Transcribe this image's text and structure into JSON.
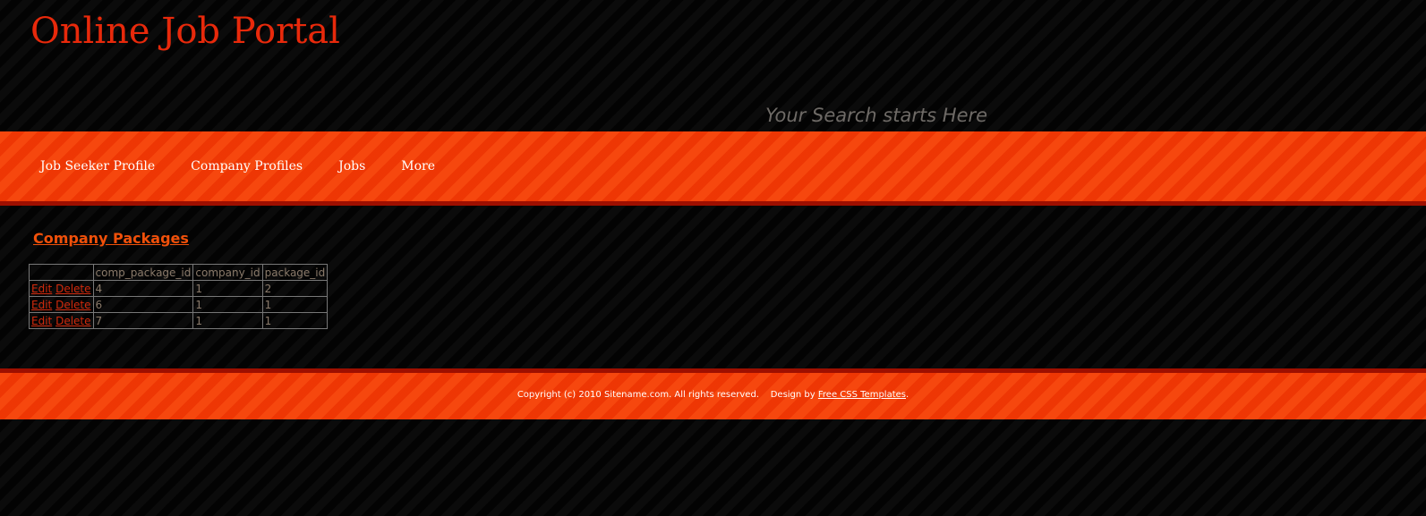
{
  "header": {
    "site_title": "Online Job Portal",
    "search_tagline": "Your Search starts Here"
  },
  "nav": {
    "items": [
      {
        "label": "Job Seeker Profile"
      },
      {
        "label": "Company Profiles"
      },
      {
        "label": "Jobs"
      },
      {
        "label": "More"
      }
    ]
  },
  "main": {
    "heading": "Company Packages",
    "table": {
      "columns": [
        "",
        "comp_package_id",
        "company_id",
        "package_id"
      ],
      "edit_label": "Edit",
      "delete_label": "Delete",
      "rows": [
        {
          "comp_package_id": "4",
          "company_id": "1",
          "package_id": "2"
        },
        {
          "comp_package_id": "6",
          "company_id": "1",
          "package_id": "1"
        },
        {
          "comp_package_id": "7",
          "company_id": "1",
          "package_id": "1"
        }
      ]
    }
  },
  "footer": {
    "copyright": "Copyright (c) 2010 Sitename.com. All rights reserved.",
    "design_prefix": "Design by",
    "design_link": "Free CSS Templates",
    "design_suffix": "."
  },
  "colors": {
    "title_red": "#e8290b",
    "nav_orange": "#f33a05",
    "heading_orange": "#f0500a",
    "link_red": "#d22a0c",
    "background": "#050505"
  }
}
